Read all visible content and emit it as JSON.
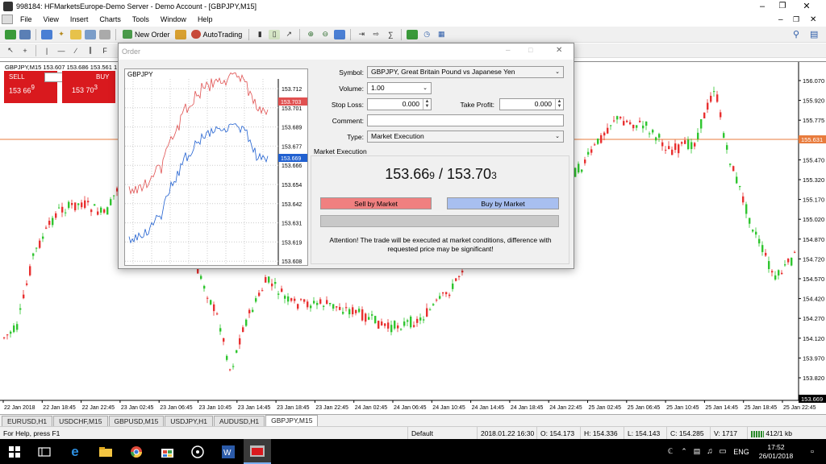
{
  "window": {
    "title": "998184: HFMarketsEurope-Demo Server - Demo Account - [GBPJPY,M15]"
  },
  "menu": [
    "File",
    "View",
    "Insert",
    "Charts",
    "Tools",
    "Window",
    "Help"
  ],
  "toolbar": {
    "new_order": "New Order",
    "autotrading": "AutoTrading"
  },
  "chart": {
    "header": "GBPJPY,M15  153.607 153.686 153.561 1",
    "price_levels": [
      "156.070",
      "155.920",
      "155.775",
      "155.631",
      "155.470",
      "155.320",
      "155.170",
      "155.020",
      "154.870",
      "154.720",
      "154.570",
      "154.420",
      "154.270",
      "154.120",
      "153.970",
      "153.820",
      "153.669"
    ],
    "current_price_tag": "155.631",
    "bid_tag": "153.669",
    "time_labels": [
      "22 Jan 2018",
      "22 Jan 18:45",
      "22 Jan 22:45",
      "23 Jan 02:45",
      "23 Jan 06:45",
      "23 Jan 10:45",
      "23 Jan 14:45",
      "23 Jan 18:45",
      "23 Jan 22:45",
      "24 Jan 02:45",
      "24 Jan 06:45",
      "24 Jan 10:45",
      "24 Jan 14:45",
      "24 Jan 18:45",
      "24 Jan 22:45",
      "25 Jan 02:45",
      "25 Jan 06:45",
      "25 Jan 10:45",
      "25 Jan 14:45",
      "25 Jan 18:45",
      "25 Jan 22:45"
    ],
    "colors": {
      "bull": "#2fc52f",
      "bear": "#e83030",
      "hline": "#e87b3c"
    }
  },
  "one_click": {
    "sell_label": "SELL",
    "buy_label": "BUY",
    "lots": "1.00",
    "sell_big": "153 66",
    "sell_sup": "9",
    "buy_big": "153 70",
    "buy_sup": "3"
  },
  "dialog": {
    "title": "Order",
    "symbol_label": "Symbol:",
    "symbol_value": "GBPJPY, Great Britain Pound vs Japanese Yen",
    "volume_label": "Volume:",
    "volume_value": "1.00",
    "stoploss_label": "Stop Loss:",
    "stoploss_value": "0.000",
    "takeprofit_label": "Take Profit:",
    "takeprofit_value": "0.000",
    "comment_label": "Comment:",
    "comment_value": "",
    "type_label": "Type:",
    "type_value": "Market Execution",
    "section_label": "Market Execution",
    "bid_main": "153.66",
    "bid_small": "9",
    "price_sep": " / ",
    "ask_main": "153.70",
    "ask_small": "3",
    "sell_button": "Sell by Market",
    "buy_button": "Buy by Market",
    "attention": "Attention! The trade will be executed at market conditions, difference with requested price may be significant!",
    "mini_chart": {
      "symbol": "GBPJPY",
      "price_labels": [
        "153.712",
        "153.701",
        "153.689",
        "153.677",
        "153.666",
        "153.654",
        "153.642",
        "153.631",
        "153.619",
        "153.608"
      ],
      "ask_tag": "153.703",
      "bid_tag": "153.669",
      "ask_color": "#e05050",
      "bid_color": "#2060d0"
    }
  },
  "tabs": [
    "EURUSD,H1",
    "USDCHF,M15",
    "GBPUSD,M15",
    "USDJPY,H1",
    "AUDUSD,H1",
    "GBPJPY,M15"
  ],
  "status": {
    "help": "For Help, press F1",
    "profile": "Default",
    "time": "2018.01.22 16:30",
    "open": "O: 154.173",
    "high": "H: 154.336",
    "low": "L: 154.143",
    "close": "C: 154.285",
    "volume": "V: 1717",
    "traffic": "412/1 kb"
  },
  "taskbar": {
    "clock_time": "17:52",
    "clock_date": "26/01/2018",
    "lang": "ENG"
  }
}
